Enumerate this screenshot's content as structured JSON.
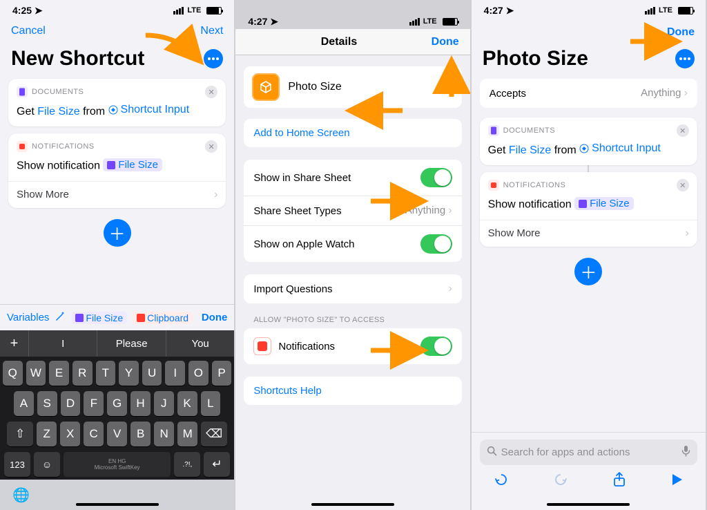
{
  "s1": {
    "time": "4:25",
    "carrier": "LTE",
    "nav_left": "Cancel",
    "nav_right": "Next",
    "title": "New Shortcut",
    "action1": {
      "category": "DOCUMENTS",
      "pre": "Get",
      "t1": "File Size",
      "mid": "from",
      "t2": "Shortcut Input"
    },
    "action2": {
      "category": "NOTIFICATIONS",
      "pre": "Show notification",
      "chip": "File Size",
      "more": "Show More"
    },
    "kbbar": {
      "vars": "Variables",
      "fsize": "File Size",
      "clip": "Clipboard",
      "done": "Done"
    },
    "predict": {
      "plus": "+",
      "p1": "I",
      "p2": "Please",
      "p3": "You"
    },
    "keys": {
      "r1": [
        "Q",
        "W",
        "E",
        "R",
        "T",
        "Y",
        "U",
        "I",
        "O",
        "P"
      ],
      "r2": [
        "A",
        "S",
        "D",
        "F",
        "G",
        "H",
        "J",
        "K",
        "L"
      ],
      "r3": [
        "Z",
        "X",
        "C",
        "V",
        "B",
        "N",
        "M"
      ],
      "n123": "123",
      "lang1": "EN HG",
      "lang2": "Microsoft SwiftKey",
      "punc": ".?!,"
    }
  },
  "s2": {
    "time": "4:27",
    "carrier": "LTE",
    "nav_center": "Details",
    "nav_right": "Done",
    "name": "Photo Size",
    "add_home": "Add to Home Screen",
    "share_sheet": "Show in Share Sheet",
    "share_types": "Share Sheet Types",
    "share_types_val": "Anything",
    "apple_watch": "Show on Apple Watch",
    "import_q": "Import Questions",
    "allow_header": "ALLOW \"PHOTO SIZE\" TO ACCESS",
    "notifications": "Notifications",
    "help": "Shortcuts Help"
  },
  "s3": {
    "time": "4:27",
    "carrier": "LTE",
    "nav_right": "Done",
    "title": "Photo Size",
    "accepts": "Accepts",
    "accepts_val": "Anything",
    "action1": {
      "category": "DOCUMENTS",
      "pre": "Get",
      "t1": "File Size",
      "mid": "from",
      "t2": "Shortcut Input"
    },
    "action2": {
      "category": "NOTIFICATIONS",
      "pre": "Show notification",
      "chip": "File Size",
      "more": "Show More"
    },
    "search_ph": "Search for apps and actions"
  }
}
